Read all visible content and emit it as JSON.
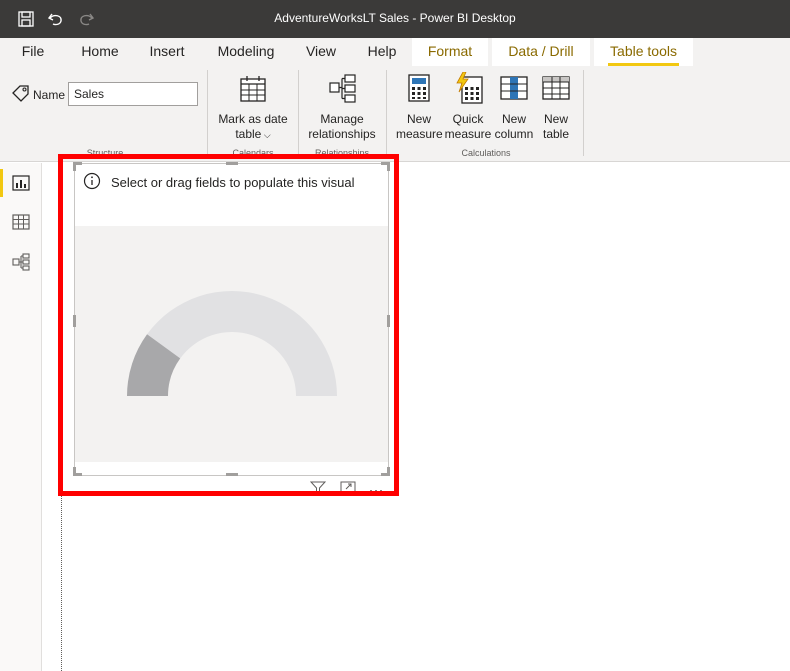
{
  "window": {
    "title": "AdventureWorksLT Sales - Power BI Desktop",
    "icons": [
      "save-icon",
      "undo-icon",
      "redo-icon"
    ]
  },
  "ribbon_tabs": [
    {
      "label": "File"
    },
    {
      "label": "Home"
    },
    {
      "label": "Insert"
    },
    {
      "label": "Modeling"
    },
    {
      "label": "View"
    },
    {
      "label": "Help"
    },
    {
      "label": "Format"
    },
    {
      "label": "Data / Drill"
    },
    {
      "label": "Table tools",
      "active": true
    }
  ],
  "ribbon": {
    "name_label": "Name",
    "name_value": "Sales",
    "mark_as_date_table": "Mark as date",
    "mark_as_date_table_line2": "table",
    "manage_relationships": "Manage",
    "manage_relationships_line2": "relationships",
    "new_measure": "New",
    "new_measure_line2": "measure",
    "quick_measure": "Quick",
    "quick_measure_line2": "measure",
    "new_column": "New",
    "new_column_line2": "column",
    "new_table": "New",
    "new_table_line2": "table",
    "groups": {
      "structure": "Structure",
      "calendars": "Calendars",
      "relationships": "Relationships",
      "calculations": "Calculations"
    }
  },
  "leftnav": {
    "items": [
      "report-view-icon",
      "data-view-icon",
      "model-view-icon"
    ]
  },
  "visual": {
    "message": "Select or drag fields to populate this visual",
    "gauge_fill_fraction": 0.2,
    "colors": {
      "gauge_track": "#e1e1e3",
      "gauge_fill": "#a8a8aa",
      "highlight": "#ff0000",
      "accent": "#f2c811"
    }
  }
}
